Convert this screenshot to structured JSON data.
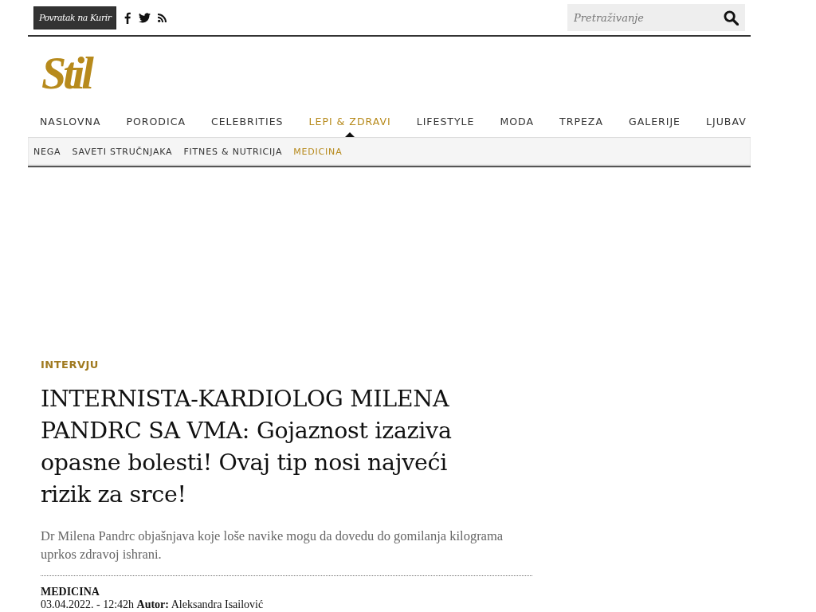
{
  "top_bar": {
    "back_link": "Povratak na Kurir",
    "search": {
      "placeholder": "Pretraživanje"
    }
  },
  "logo": "Stil",
  "nav": [
    {
      "label": "NASLOVNA",
      "selected": false
    },
    {
      "label": "PORODICA",
      "selected": false
    },
    {
      "label": "CELEBRITIES",
      "selected": false
    },
    {
      "label": "LEPI & ZDRAVI",
      "selected": true
    },
    {
      "label": "LIFESTYLE",
      "selected": false
    },
    {
      "label": "MODA",
      "selected": false
    },
    {
      "label": "TRPEZA",
      "selected": false
    },
    {
      "label": "GALERIJE",
      "selected": false
    },
    {
      "label": "LJUBAV",
      "selected": false
    }
  ],
  "subnav": [
    {
      "label": "NEGA",
      "selected": false
    },
    {
      "label": "SAVETI STRUČNJAKA",
      "selected": false
    },
    {
      "label": "FITNES & NUTRICIJA",
      "selected": false
    },
    {
      "label": "MEDICINA",
      "selected": true
    }
  ],
  "article": {
    "kicker": "INTERVJU",
    "headline": "INTERNISTA-KARDIOLOG MILENA PANDRC SA VMA: Gojaznost izaziva opasne bolesti! Ovaj tip nosi najveći rizik za srce!",
    "lead": "Dr Milena Pandrc objašnjava koje loše navike mogu da dovedu do gomilanja kilograma uprkos zdravoj ishrani.",
    "section": "MEDICINA",
    "meta": "03.04.2022. - 12:42h **Autor:** Aleksandra Isailović"
  }
}
